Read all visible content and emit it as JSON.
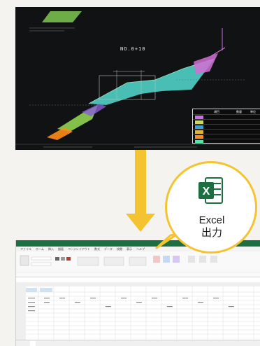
{
  "cad": {
    "section_label": "NO.0+10",
    "legend_headers": [
      "項目",
      "数量",
      "単位"
    ],
    "legend_colors": [
      "#c86fe0",
      "#c8d860",
      "#3aa0d8",
      "#e0b43c",
      "#ff8c1a",
      "#5be0a8"
    ]
  },
  "callout": {
    "line1": "Excel",
    "line2": "出力",
    "icon_letter": "X",
    "accent": "#f4c430",
    "excel_green": "#1d6f42"
  },
  "sheet": {
    "menu": [
      "ファイル",
      "ホーム",
      "挿入",
      "描画",
      "ページレイアウト",
      "数式",
      "データ",
      "校閲",
      "表示",
      "ヘルプ"
    ]
  }
}
